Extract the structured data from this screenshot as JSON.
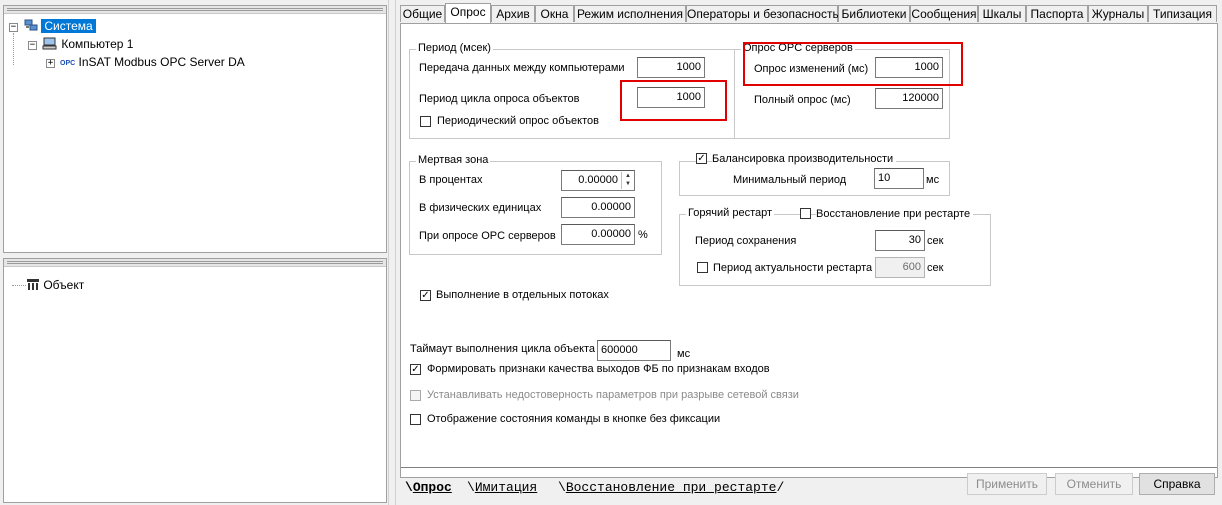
{
  "tree_top": {
    "root_label": "Система",
    "computer_label": "Компьютер 1",
    "opc_badge": "OPC",
    "opc_server_label": "InSAT Modbus OPC Server DA"
  },
  "tree_bottom": {
    "object_label": "Объект"
  },
  "tabs": [
    "Общие",
    "Опрос",
    "Архив",
    "Окна",
    "Режим исполнения",
    "Операторы и безопасность",
    "Библиотеки",
    "Сообщения",
    "Шкалы",
    "Паспорта",
    "Журналы",
    "Типизация"
  ],
  "period": {
    "title": "Период (мсек)",
    "transfer_label": "Передача данных между компьютерами",
    "transfer_value": "1000",
    "cycle_label": "Период цикла опроса объектов",
    "cycle_value": "1000",
    "periodic_label": "Периодический опрос объектов",
    "periodic_checked": false
  },
  "opc": {
    "title": "Опрос OPC серверов",
    "changes_label": "Опрос изменений (мс)",
    "changes_value": "1000",
    "full_label": "Полный опрос (мс)",
    "full_value": "120000"
  },
  "deadzone": {
    "title": "Мертвая зона",
    "percent_label": "В процентах",
    "percent_value": "0.00000",
    "physical_label": "В физических единицах",
    "physical_value": "0.00000",
    "opc_label": "При опросе OPC серверов",
    "opc_value": "0.00000",
    "percent_sign": "%"
  },
  "balance": {
    "label": "Балансировка производительности",
    "checked": true,
    "min_period_label": "Минимальный период",
    "min_period_value": "10",
    "unit": "мс"
  },
  "hot_restart": {
    "title": "Горячий рестарт",
    "restore_label": "Восстановление при рестарте",
    "restore_checked": false,
    "save_period_label": "Период сохранения",
    "save_period_value": "30",
    "save_unit": "сек",
    "actuality_label": "Период актуальности рестарта",
    "actuality_checked": false,
    "actuality_value": "600",
    "actuality_unit": "сек"
  },
  "threads": {
    "label": "Выполнение в отдельных потоках",
    "checked": true
  },
  "timeout": {
    "label": "Таймаут выполнения цикла объекта",
    "value": "600000",
    "unit": "мс"
  },
  "options": {
    "quality_label": "Формировать признаки качества выходов ФБ по признакам входов",
    "quality_checked": true,
    "unreliable_label": "Устанавливать недостоверность параметров при разрыве сетевой связи",
    "unreliable_checked": false,
    "display_label": "Отображение состояния команды в кнопке без фиксации",
    "display_checked": false
  },
  "bottom_tabs": [
    "Опрос",
    "Имитация",
    "Восстановление при рестарте"
  ],
  "buttons": {
    "apply": "Применить",
    "cancel": "Отменить",
    "help": "Справка"
  }
}
